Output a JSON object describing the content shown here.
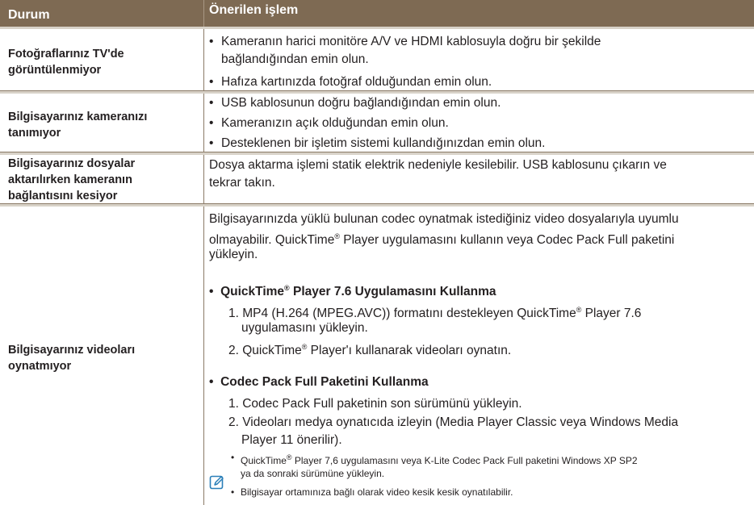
{
  "header": {
    "col1": "Durum",
    "col2": "Önerilen işlem"
  },
  "rows": {
    "r1": {
      "label": "Fotoğraflarınız TV'de görüntülenmiyor",
      "b1a": "Kameranın harici monitöre A/V  ve  HDMI kablosuyla doğru bir şekilde",
      "b1b": "bağlandığından emin olun.",
      "b2": "Hafıza kartınızda fotoğraf olduğundan emin olun."
    },
    "r2": {
      "label": "Bilgisayarınız kameranızı tanımıyor",
      "b1": "USB kablosunun doğru bağlandığından emin olun.",
      "b2": "Kameranızın açık olduğundan emin olun.",
      "b3": "Desteklenen bir işletim sistemi kullandığınızdan emin olun."
    },
    "r3": {
      "label": "Bilgisayarınız dosyalar aktarılırken kameranın bağlantısını kesiyor",
      "l1": "Dosya aktarma işlemi statik elektrik nedeniyle kesilebilir. USB kablosunu çıkarın ve",
      "l2": "tekrar takın."
    },
    "r4": {
      "label": "Bilgisayarınız videoları oynatmıyor",
      "p1": "Bilgisayarınızda yüklü bulunan codec oynatmak istediğiniz video dosyalarıyla uyumlu",
      "p2a": "olmayabilir. QuickTime",
      "p2b": " Player uygulamasını kullanın veya Codec Pack Full paketini",
      "p3": "yükleyin.",
      "reg": "®",
      "h1a": "QuickTime",
      "h1b": " Player 7.6 Uygulamasını Kullanma",
      "s1a": "1. MP4 (H.264 (MPEG.AVC)) formatını destekleyen QuickTime",
      "s1b": " Player 7.6",
      "s1c": "uygulamasını yükleyin.",
      "s2a": "2. QuickTime",
      "s2b": " Player'ı kullanarak videoları oynatın.",
      "h2": "Codec Pack Full Paketini Kullanma",
      "t1": "1. Codec Pack Full paketinin son sürümünü yükleyin.",
      "t2a": "2. Videoları medya oynatıcıda izleyin (Media Player Classic veya Windows Media",
      "t2b": "Player 11 önerilir).",
      "n1a": "QuickTime",
      "n1b": " Player 7,6 uygulamasını veya K-Lite Codec Pack Full paketini Windows XP SP2",
      "n1c": "ya da sonraki sürümüne yükleyin.",
      "n2": "Bilgisayar ortamınıza bağlı olarak video kesik kesik oynatılabilir."
    }
  },
  "bullet_char": "•",
  "icons": {
    "note": "note-pencil-icon"
  },
  "colors": {
    "header_bg": "#7e6a53",
    "rule": "#8a7a66",
    "icon": "#2a7fb8"
  }
}
